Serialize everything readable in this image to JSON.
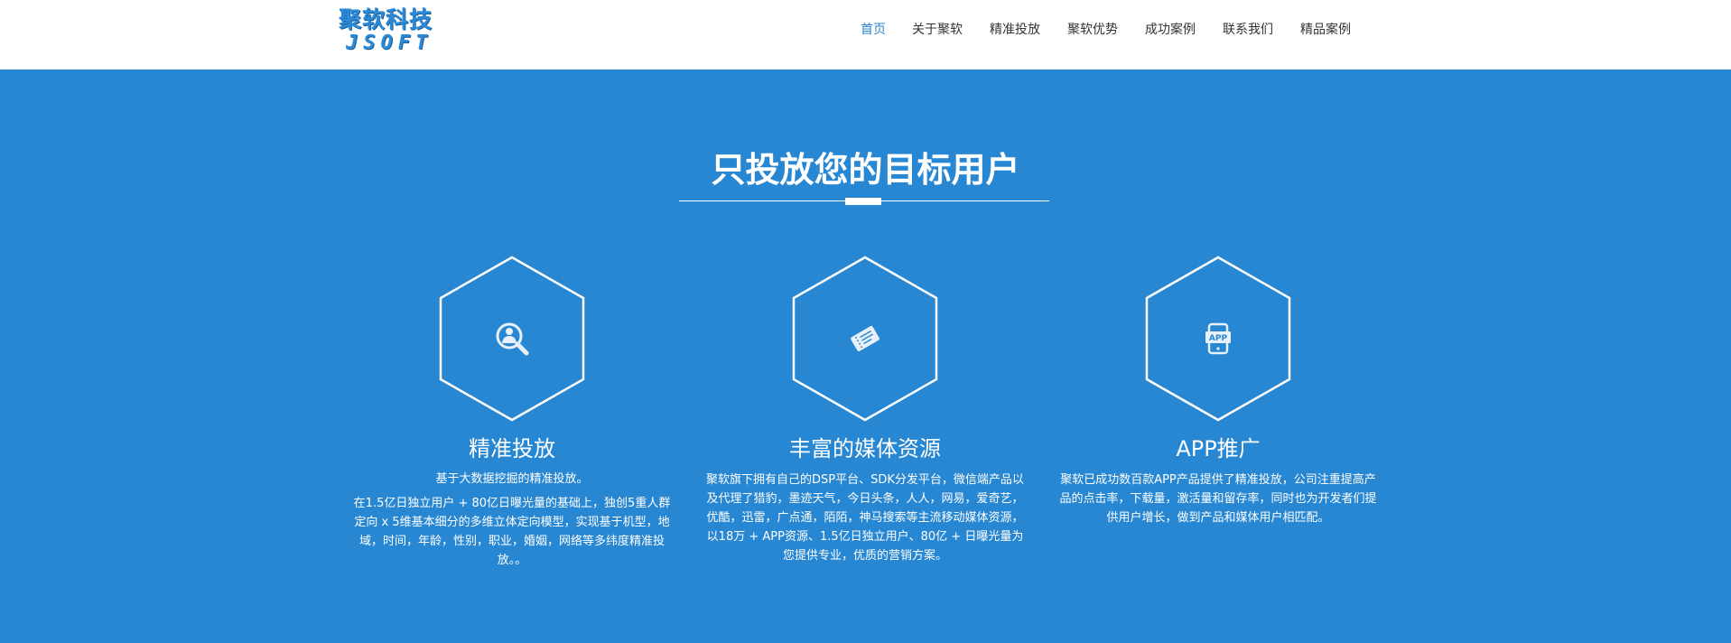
{
  "logo": {
    "chinese": "聚软科技",
    "english": "JSOFT"
  },
  "nav": {
    "items": [
      {
        "label": "首页",
        "active": true
      },
      {
        "label": "关于聚软",
        "active": false
      },
      {
        "label": "精准投放",
        "active": false
      },
      {
        "label": "聚软优势",
        "active": false
      },
      {
        "label": "成功案例",
        "active": false
      },
      {
        "label": "联系我们",
        "active": false
      },
      {
        "label": "精品案例",
        "active": false
      }
    ]
  },
  "section": {
    "title": "只投放您的目标用户"
  },
  "features": [
    {
      "icon": "search-person-icon",
      "title": "精准投放",
      "subtitle": "基于大数据挖掘的精准投放。",
      "description": "在1.5亿日独立用户 + 80亿日曝光量的基础上，独创5重人群定向 x 5维基本细分的多维立体定向模型，实现基于机型，地域，时间，年龄，性别，职业，婚姻，网络等多纬度精准投放。。"
    },
    {
      "icon": "ticket-icon",
      "title": "丰富的媒体资源",
      "subtitle": "",
      "description": "聚软旗下拥有自己的DSP平台、SDK分发平台，微信端产品以及代理了猎豹，墨迹天气，今日头条，人人，网易，爱奇艺，优酷，迅雷，广点通，陌陌，神马搜索等主流移动媒体资源，以18万 + APP资源、1.5亿日独立用户、80亿 + 日曝光量为您提供专业，优质的营销方案。"
    },
    {
      "icon": "app-phone-icon",
      "title": "APP推广",
      "subtitle": "",
      "description": "聚软已成功数百款APP产品提供了精准投放，公司注重提高产品的点击率，下载量，激活量和留存率，同时也为开发者们提供用户增长，做到产品和媒体用户相匹配。"
    }
  ],
  "colors": {
    "brand": "#2a8ad8",
    "hero_background": "#2887d3",
    "nav_active": "#2a86d6",
    "nav_text": "#333333"
  }
}
